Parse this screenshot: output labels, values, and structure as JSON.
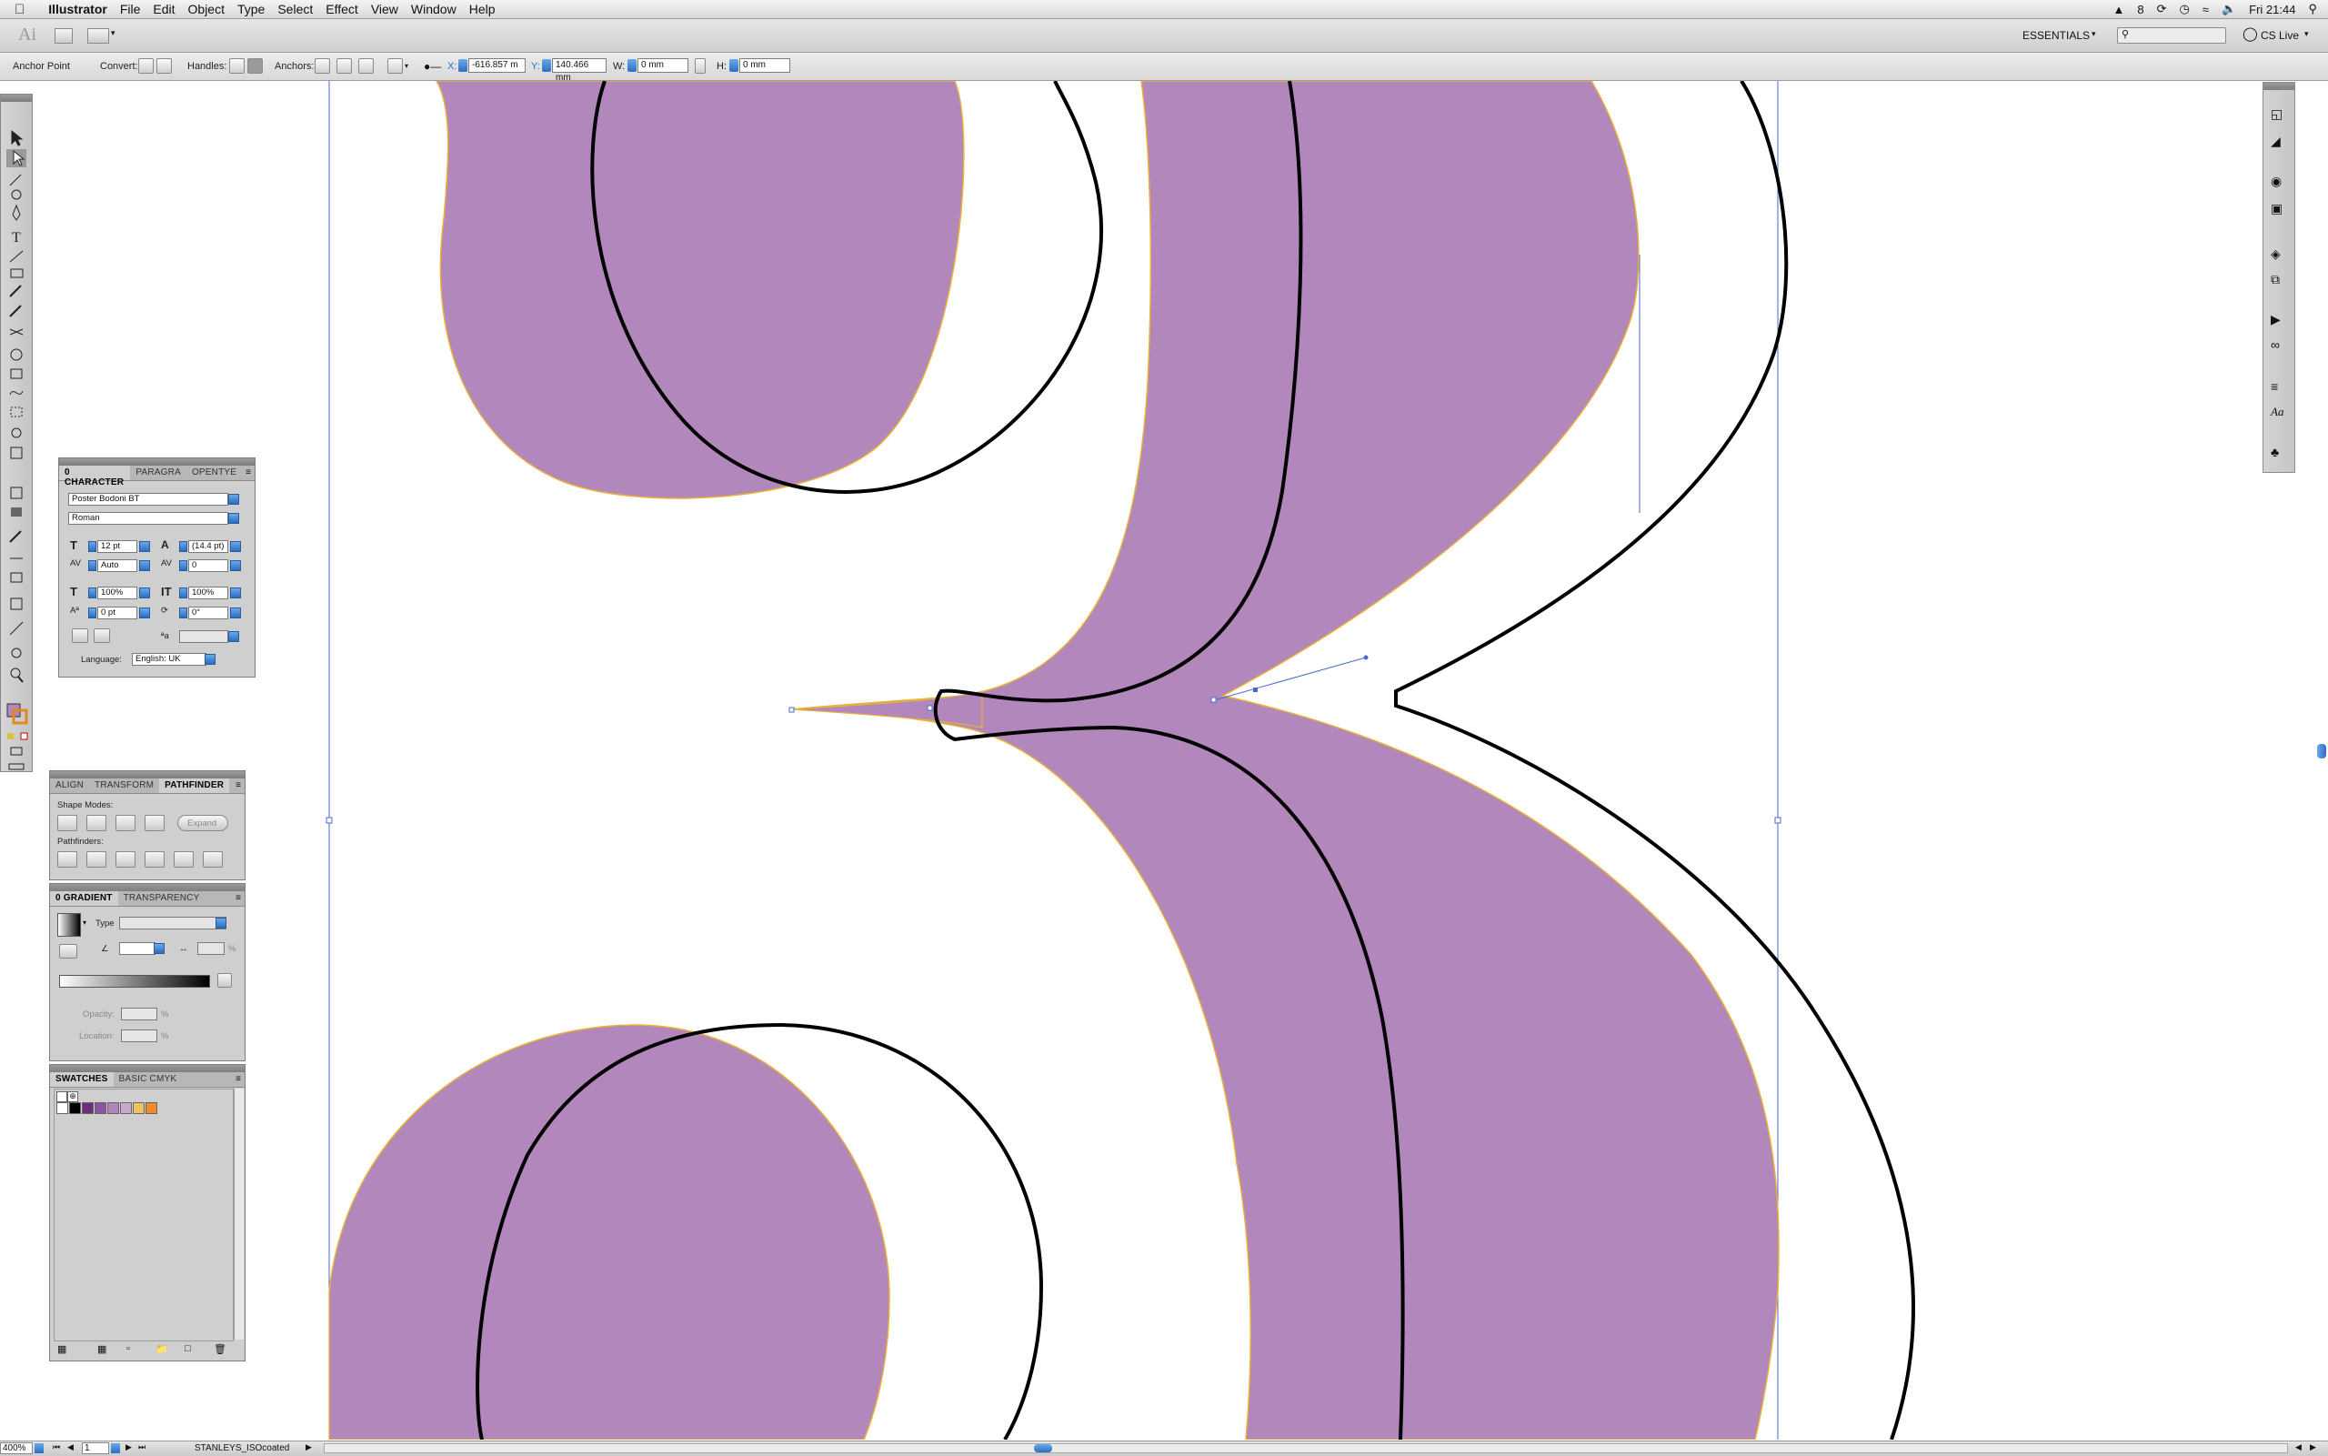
{
  "menubar": {
    "app_name": "Illustrator",
    "items": [
      "File",
      "Edit",
      "Object",
      "Type",
      "Select",
      "Effect",
      "View",
      "Window",
      "Help"
    ],
    "status_count": "8",
    "clock": "Fri 21:44"
  },
  "appbar": {
    "logo": "Ai",
    "workspace": "ESSENTIALS",
    "cslive": "CS Live"
  },
  "controlbar": {
    "tool_name": "Anchor Point",
    "convert_label": "Convert:",
    "handles_label": "Handles:",
    "anchors_label": "Anchors:",
    "x_label": "X:",
    "x_value": "-616.857 m",
    "y_label": "Y:",
    "y_value": "140.466 mm",
    "w_label": "W:",
    "w_value": "0 mm",
    "h_label": "H:",
    "h_value": "0 mm"
  },
  "character_panel": {
    "tabs": [
      "0 CHARACTER",
      "PARAGRA",
      "OPENTYE"
    ],
    "font_family": "Poster Bodoni BT",
    "font_style": "Roman",
    "font_size": "12 pt",
    "leading": "(14.4 pt)",
    "kerning": "Auto",
    "tracking": "0",
    "horizontal_scale": "100%",
    "vertical_scale": "100%",
    "baseline_shift": "0 pt",
    "rotation": "0°",
    "language_label": "Language:",
    "language": "English: UK"
  },
  "pathfinder_panel": {
    "tabs": [
      "ALIGN",
      "TRANSFORM",
      "PATHFINDER"
    ],
    "shape_modes_label": "Shape Modes:",
    "expand_label": "Expand",
    "pathfinders_label": "Pathfinders:"
  },
  "gradient_panel": {
    "tabs": [
      "0 GRADIENT",
      "TRANSPARENCY"
    ],
    "type_label": "Type",
    "opacity_label": "Opacity:",
    "location_label": "Location:",
    "percent": "%"
  },
  "swatches_panel": {
    "tabs": [
      "SWATCHES",
      "BASIC CMYK"
    ],
    "swatch_colors": [
      "#ffffff",
      "#000000",
      "#6a2f76",
      "#8c55a3",
      "#b185bb",
      "#c9a7cf",
      "#f0c060",
      "#f08a2a"
    ]
  },
  "statusbar": {
    "zoom": "400%",
    "page": "1",
    "profile": "STANLEYS_ISOcoated"
  },
  "colors": {
    "glyph_fill": "#b287bb",
    "selection_outline": "#e9b338",
    "guide_line": "#4a69c8"
  }
}
